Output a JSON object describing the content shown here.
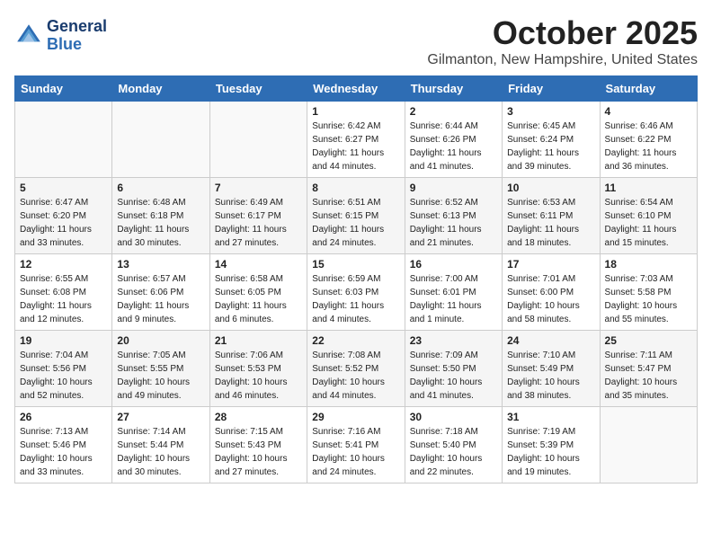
{
  "header": {
    "logo_line1": "General",
    "logo_line2": "Blue",
    "month": "October 2025",
    "location": "Gilmanton, New Hampshire, United States"
  },
  "weekdays": [
    "Sunday",
    "Monday",
    "Tuesday",
    "Wednesday",
    "Thursday",
    "Friday",
    "Saturday"
  ],
  "weeks": [
    [
      {
        "day": "",
        "info": ""
      },
      {
        "day": "",
        "info": ""
      },
      {
        "day": "",
        "info": ""
      },
      {
        "day": "1",
        "info": "Sunrise: 6:42 AM\nSunset: 6:27 PM\nDaylight: 11 hours\nand 44 minutes."
      },
      {
        "day": "2",
        "info": "Sunrise: 6:44 AM\nSunset: 6:26 PM\nDaylight: 11 hours\nand 41 minutes."
      },
      {
        "day": "3",
        "info": "Sunrise: 6:45 AM\nSunset: 6:24 PM\nDaylight: 11 hours\nand 39 minutes."
      },
      {
        "day": "4",
        "info": "Sunrise: 6:46 AM\nSunset: 6:22 PM\nDaylight: 11 hours\nand 36 minutes."
      }
    ],
    [
      {
        "day": "5",
        "info": "Sunrise: 6:47 AM\nSunset: 6:20 PM\nDaylight: 11 hours\nand 33 minutes."
      },
      {
        "day": "6",
        "info": "Sunrise: 6:48 AM\nSunset: 6:18 PM\nDaylight: 11 hours\nand 30 minutes."
      },
      {
        "day": "7",
        "info": "Sunrise: 6:49 AM\nSunset: 6:17 PM\nDaylight: 11 hours\nand 27 minutes."
      },
      {
        "day": "8",
        "info": "Sunrise: 6:51 AM\nSunset: 6:15 PM\nDaylight: 11 hours\nand 24 minutes."
      },
      {
        "day": "9",
        "info": "Sunrise: 6:52 AM\nSunset: 6:13 PM\nDaylight: 11 hours\nand 21 minutes."
      },
      {
        "day": "10",
        "info": "Sunrise: 6:53 AM\nSunset: 6:11 PM\nDaylight: 11 hours\nand 18 minutes."
      },
      {
        "day": "11",
        "info": "Sunrise: 6:54 AM\nSunset: 6:10 PM\nDaylight: 11 hours\nand 15 minutes."
      }
    ],
    [
      {
        "day": "12",
        "info": "Sunrise: 6:55 AM\nSunset: 6:08 PM\nDaylight: 11 hours\nand 12 minutes."
      },
      {
        "day": "13",
        "info": "Sunrise: 6:57 AM\nSunset: 6:06 PM\nDaylight: 11 hours\nand 9 minutes."
      },
      {
        "day": "14",
        "info": "Sunrise: 6:58 AM\nSunset: 6:05 PM\nDaylight: 11 hours\nand 6 minutes."
      },
      {
        "day": "15",
        "info": "Sunrise: 6:59 AM\nSunset: 6:03 PM\nDaylight: 11 hours\nand 4 minutes."
      },
      {
        "day": "16",
        "info": "Sunrise: 7:00 AM\nSunset: 6:01 PM\nDaylight: 11 hours\nand 1 minute."
      },
      {
        "day": "17",
        "info": "Sunrise: 7:01 AM\nSunset: 6:00 PM\nDaylight: 10 hours\nand 58 minutes."
      },
      {
        "day": "18",
        "info": "Sunrise: 7:03 AM\nSunset: 5:58 PM\nDaylight: 10 hours\nand 55 minutes."
      }
    ],
    [
      {
        "day": "19",
        "info": "Sunrise: 7:04 AM\nSunset: 5:56 PM\nDaylight: 10 hours\nand 52 minutes."
      },
      {
        "day": "20",
        "info": "Sunrise: 7:05 AM\nSunset: 5:55 PM\nDaylight: 10 hours\nand 49 minutes."
      },
      {
        "day": "21",
        "info": "Sunrise: 7:06 AM\nSunset: 5:53 PM\nDaylight: 10 hours\nand 46 minutes."
      },
      {
        "day": "22",
        "info": "Sunrise: 7:08 AM\nSunset: 5:52 PM\nDaylight: 10 hours\nand 44 minutes."
      },
      {
        "day": "23",
        "info": "Sunrise: 7:09 AM\nSunset: 5:50 PM\nDaylight: 10 hours\nand 41 minutes."
      },
      {
        "day": "24",
        "info": "Sunrise: 7:10 AM\nSunset: 5:49 PM\nDaylight: 10 hours\nand 38 minutes."
      },
      {
        "day": "25",
        "info": "Sunrise: 7:11 AM\nSunset: 5:47 PM\nDaylight: 10 hours\nand 35 minutes."
      }
    ],
    [
      {
        "day": "26",
        "info": "Sunrise: 7:13 AM\nSunset: 5:46 PM\nDaylight: 10 hours\nand 33 minutes."
      },
      {
        "day": "27",
        "info": "Sunrise: 7:14 AM\nSunset: 5:44 PM\nDaylight: 10 hours\nand 30 minutes."
      },
      {
        "day": "28",
        "info": "Sunrise: 7:15 AM\nSunset: 5:43 PM\nDaylight: 10 hours\nand 27 minutes."
      },
      {
        "day": "29",
        "info": "Sunrise: 7:16 AM\nSunset: 5:41 PM\nDaylight: 10 hours\nand 24 minutes."
      },
      {
        "day": "30",
        "info": "Sunrise: 7:18 AM\nSunset: 5:40 PM\nDaylight: 10 hours\nand 22 minutes."
      },
      {
        "day": "31",
        "info": "Sunrise: 7:19 AM\nSunset: 5:39 PM\nDaylight: 10 hours\nand 19 minutes."
      },
      {
        "day": "",
        "info": ""
      }
    ]
  ]
}
